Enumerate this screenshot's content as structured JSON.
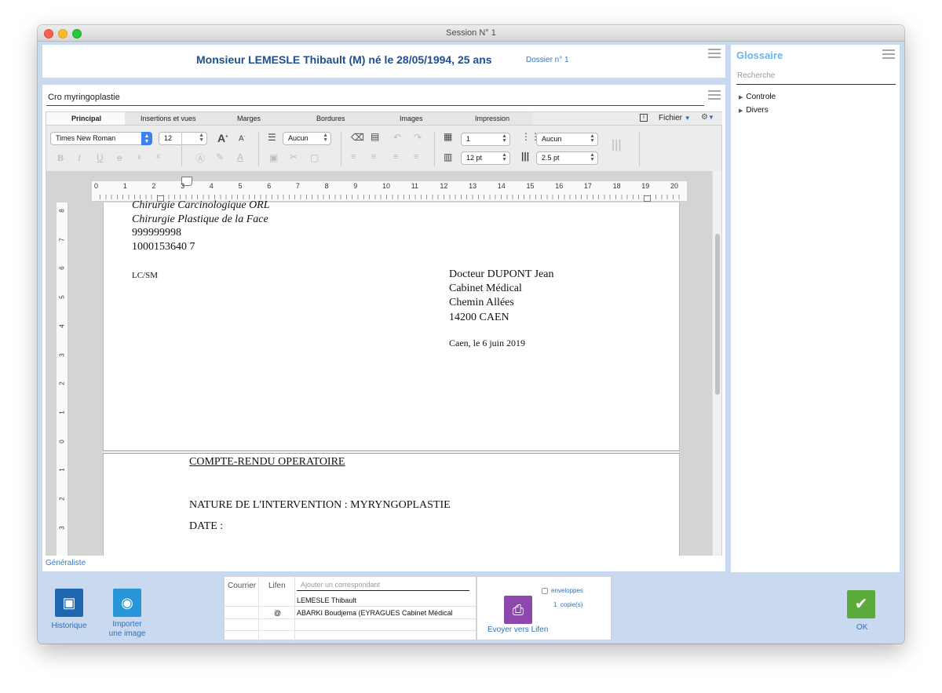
{
  "window": {
    "title": "Session N° 1"
  },
  "patient": {
    "header": "Monsieur LEMESLE Thibault (M) né le 28/05/1994, 25 ans",
    "dossier": "Dossier n° 1"
  },
  "document": {
    "title": "Cro myringoplastie"
  },
  "tabs": [
    "Principal",
    "Insertions et vues",
    "Marges",
    "Bordures",
    "Images",
    "Impression"
  ],
  "tabbar_right": {
    "file_menu": "Fichier"
  },
  "toolbar": {
    "font": "Times New Roman",
    "size": "12",
    "list_style": "Aucun",
    "line_spacing": "1",
    "spacing_pt": "12 pt",
    "border_style": "Aucun",
    "border_pt": "2.5 pt"
  },
  "ruler": {
    "h_ticks": [
      "0",
      "1",
      "2",
      "3",
      "4",
      "5",
      "6",
      "7",
      "8",
      "9",
      "10",
      "11",
      "12",
      "13",
      "14",
      "15",
      "16",
      "17",
      "18",
      "19",
      "20"
    ],
    "v_ticks": [
      "8",
      "7",
      "6",
      "5",
      "4",
      "3",
      "2",
      "1",
      "0",
      "1",
      "2",
      "3"
    ]
  },
  "letter": {
    "left_lines": [
      "Chirurgie Carcinologique ORL",
      "Chirurgie Plastique de la Face"
    ],
    "ids": [
      "999999998",
      "1000153640 7"
    ],
    "ref": "LC/SM",
    "recipient": [
      "Docteur DUPONT Jean",
      "Cabinet Médical",
      "Chemin Allées",
      "14200 CAEN"
    ],
    "date_line": "Caen, le 6 juin 2019",
    "report_title": "COMPTE-RENDU OPERATOIRE",
    "nature": "NATURE DE L'INTERVENTION :  MYRYNGOPLASTIE",
    "date_label": "DATE :"
  },
  "footer_label": "Généraliste",
  "glossaire": {
    "title": "Glossaire",
    "search_placeholder": "Recherche",
    "items": [
      "Controle",
      "Divers"
    ]
  },
  "bottom": {
    "historique": "Historique",
    "importer_1": "Importer",
    "importer_2": "une image",
    "table_headers": {
      "courrier": "Courrier",
      "lifen": "Lifen"
    },
    "add_placeholder": "Ajouter un correspondant",
    "rows": [
      {
        "lifen": "",
        "name": "LEMESLE Thibault"
      },
      {
        "lifen": "@",
        "name": "ABARKI Boudjema (EYRAGUES Cabinet Médical"
      }
    ],
    "enveloppes": "enveloppes",
    "copies_count": "1",
    "copies_label": "copie(s)",
    "send_lifen": "Evoyer vers Lifen",
    "ok": "OK"
  },
  "colors": {
    "accent": "#1f4f8c",
    "link": "#3a77c0",
    "glossaire": "#6cb3ef",
    "ok": "#5aab3b",
    "lifen": "#8d48ad",
    "import": "#2795d8",
    "historique": "#1f67b1"
  }
}
